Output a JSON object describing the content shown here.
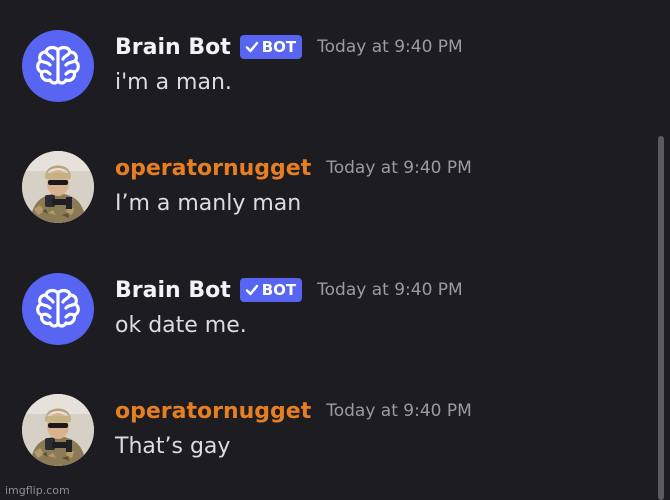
{
  "messages": [
    {
      "username": "Brain Bot",
      "is_bot": true,
      "badge": "BOT",
      "timestamp": "Today at 9:40 PM",
      "content": "i'm a man.",
      "avatar_icon": "brain-icon",
      "name_color": "#f2f3f5"
    },
    {
      "username": "operatornugget",
      "is_bot": false,
      "timestamp": "Today at 9:40 PM",
      "content": "I’m a manly man",
      "avatar_icon": "user-photo-avatar",
      "name_color": "#e67e22"
    },
    {
      "username": "Brain Bot",
      "is_bot": true,
      "badge": "BOT",
      "timestamp": "Today at 9:40 PM",
      "content": "ok date me.",
      "avatar_icon": "brain-icon",
      "name_color": "#f2f3f5"
    },
    {
      "username": "operatornugget",
      "is_bot": false,
      "timestamp": "Today at 9:40 PM",
      "content": "That’s gay",
      "avatar_icon": "user-photo-avatar",
      "name_color": "#e67e22"
    }
  ],
  "watermark": "imgflip.com",
  "colors": {
    "background": "#1c1c21",
    "bot_badge": "#5865f2",
    "username_highlight": "#e67e22"
  }
}
